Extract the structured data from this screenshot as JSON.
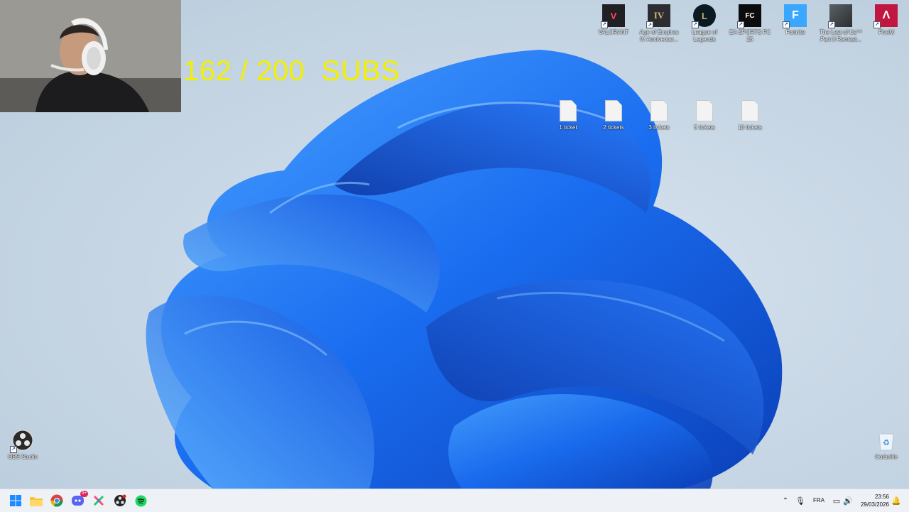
{
  "overlay": {
    "subs_text": "162 / 200  SUBS"
  },
  "desktop": {
    "top_icons": [
      {
        "name": "VALORANT",
        "label": "VALORANT",
        "icon": "valorant-icon",
        "color": "#1f1f24",
        "accent": "#ff4655"
      },
      {
        "name": "age-of-empires",
        "label": "Age of Empires IV Anniversar...",
        "icon": "age-of-empires-icon",
        "color": "#2b2d33",
        "accent": "#d9b46a"
      },
      {
        "name": "league-of-legends",
        "label": "League of Legends",
        "icon": "league-of-legends-icon",
        "color": "#0b1a22",
        "accent": "#c8aa6e"
      },
      {
        "name": "ea-sports-fc",
        "label": "EA SPORTS FC 25",
        "icon": "ea-sports-fc-icon",
        "color": "#0c0c0c",
        "accent": "#ffffff"
      },
      {
        "name": "fortnite",
        "label": "Fortnite",
        "icon": "fortnite-icon",
        "color": "#39a7ff",
        "accent": "#ffffff"
      },
      {
        "name": "the-last-of-us",
        "label": "The Last of Us™ Part II Remast...",
        "icon": "the-last-of-us-icon",
        "color": "#3b3f42",
        "accent": "#9aa2a6"
      },
      {
        "name": "fivem",
        "label": "FiveM",
        "icon": "fivem-icon",
        "color": "#c0163f",
        "accent": "#ffffff"
      }
    ],
    "file_icons": [
      {
        "label": "1 ticket"
      },
      {
        "label": "2 tickets"
      },
      {
        "label": "3 tickets"
      },
      {
        "label": "5 tickets"
      },
      {
        "label": "10 tickets"
      }
    ],
    "obs": {
      "label": "OBS Studio",
      "icon": "obs-studio-icon"
    },
    "recycle_bin": {
      "label": "Corbeille",
      "icon": "recycle-bin-icon"
    }
  },
  "taskbar": {
    "apps": [
      {
        "name": "start",
        "icon": "windows-start-icon"
      },
      {
        "name": "file-explorer",
        "icon": "folder-icon"
      },
      {
        "name": "chrome",
        "icon": "chrome-icon"
      },
      {
        "name": "discord",
        "icon": "discord-icon",
        "badge": "9+"
      },
      {
        "name": "app-x",
        "icon": "colorful-x-icon"
      },
      {
        "name": "obs",
        "icon": "obs-taskbar-icon"
      },
      {
        "name": "spotify",
        "icon": "spotify-icon"
      }
    ],
    "tray": {
      "language": "FRA",
      "time": "23:56",
      "date": "29/03/2026"
    }
  }
}
